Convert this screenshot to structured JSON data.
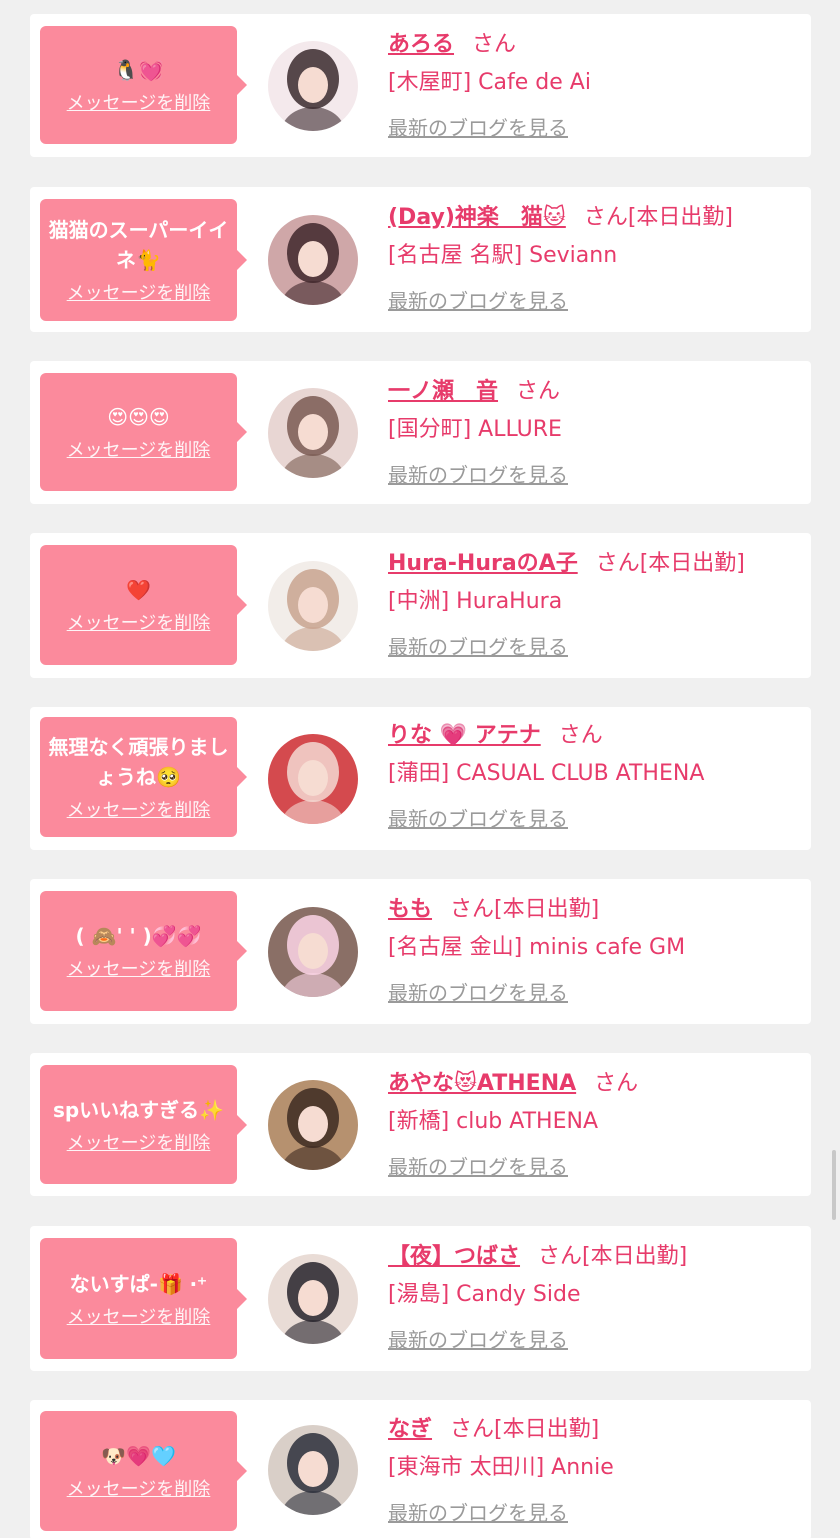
{
  "labels": {
    "delete": "メッセージを削除",
    "blog": "最新のブログを見る",
    "san": "さん",
    "working": "[本日出勤]"
  },
  "colors": {
    "accent": "#e73b6b",
    "bubble": "#fb8a9c",
    "background": "#f0f0f0",
    "card": "#ffffff",
    "link_gray": "#9a9a9a"
  },
  "items": [
    {
      "message": "🐧💓",
      "name": "あろる",
      "working": false,
      "shop": "[木屋町] Cafe de Ai"
    },
    {
      "message": "猫猫のスーパーイイネ🐈",
      "name": "(Day)神楽　猫🐱",
      "working": true,
      "shop": "[名古屋 名駅] Seviann"
    },
    {
      "message": "😍😍😍",
      "name": "一ノ瀬　音",
      "working": false,
      "shop": "[国分町] ALLURE"
    },
    {
      "message": "❤️",
      "name": "Hura-HuraのA子",
      "working": true,
      "shop": "[中洲] HuraHura"
    },
    {
      "message": "無理なく頑張りましょうね🥺",
      "name": "りな 💗 アテナ",
      "working": false,
      "shop": "[蒲田] CASUAL CLUB ATHENA"
    },
    {
      "message": "( 🙈' ' )💞💞",
      "name": "もも",
      "working": true,
      "shop": "[名古屋 金山] minis cafe GM"
    },
    {
      "message": "spいいねすぎる✨",
      "name": "あやな😻ATHENA",
      "working": false,
      "shop": "[新橋] club ATHENA"
    },
    {
      "message": "ないすぱ-🎁 ‧⁺",
      "name": "【夜】つばさ",
      "working": true,
      "shop": "[湯島] Candy Side"
    },
    {
      "message": "🐶💗🩵",
      "name": "なぎ",
      "working": true,
      "shop": "[東海市 太田川] Annie"
    }
  ]
}
